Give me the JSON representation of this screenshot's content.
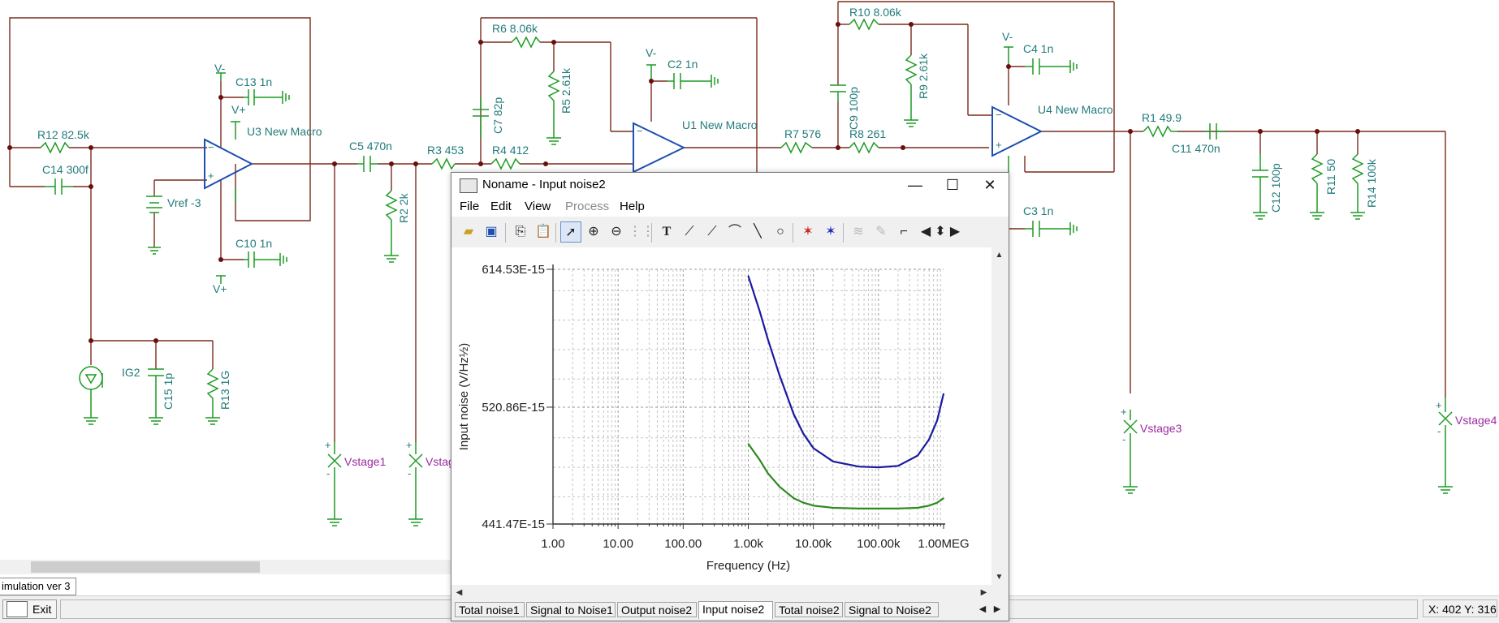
{
  "schematic": {
    "labels": {
      "r12": "R12 82.5k",
      "c14": "C14 300f",
      "c13": "C13 1n",
      "vminus_u3": "V-",
      "vplus_u3_top": "V+",
      "u3": "U3 New Macro",
      "vref": "Vref -3",
      "c10": "C10 1n",
      "vplus_u3_bot": "V+",
      "ig2": "IG2",
      "c15": "C15 1p",
      "r13": "R13 1G",
      "c5": "C5 470n",
      "r2": "R2 2k",
      "r3": "R3 453",
      "r4": "R4 412",
      "r6": "R6 8.06k",
      "c7": "C7 82p",
      "r5": "R5 2.61k",
      "vminus_u1": "V-",
      "c2": "C2 1n",
      "u1": "U1 New Macro",
      "r7": "R7 576",
      "r8": "R8 261",
      "c9": "C9 100p",
      "r10": "R10 8.06k",
      "r9": "R9 2.61k",
      "vminus_u4": "V-",
      "c4": "C4 1n",
      "u4": "U4 New Macro",
      "c3": "C3 1n",
      "r1": "R1 49.9",
      "c11": "C11 470n",
      "c12": "C12 100p",
      "r11": "R11 50",
      "r14": "R14 100k",
      "vstage1": "Vstage1",
      "vstage2": "Vstag",
      "vstage3": "Vstage3",
      "vstage4": "Vstage4"
    }
  },
  "main": {
    "tab_label": "imulation ver 3",
    "exit_label": "Exit",
    "coords": "X: 402  Y: 316"
  },
  "window": {
    "title": "Noname - Input noise2",
    "menu": [
      "File",
      "Edit",
      "View",
      "Process",
      "Help"
    ],
    "menu_disabled": [
      false,
      false,
      false,
      true,
      false
    ],
    "tabs": [
      "Total noise1",
      "Signal to Noise1",
      "Output noise2",
      "Input noise2",
      "Total noise2",
      "Signal to Noise2"
    ],
    "active_tab": "Input noise2",
    "toolbar_icons": [
      "open-icon",
      "save-icon",
      "copy-icon",
      "paste-icon",
      "pointer-icon",
      "zoom-in-icon",
      "zoom-out-icon",
      "grid-icon",
      "text-icon",
      "cursor-a-icon",
      "cursor-b-icon",
      "line-tool-icon",
      "line-icon",
      "circle-icon",
      "cursor-a-marker-icon",
      "cursor-b-marker-icon",
      "curve-icon",
      "pen-icon",
      "step-icon"
    ]
  },
  "chart_data": {
    "type": "line",
    "title": "",
    "xlabel": "Frequency (Hz)",
    "ylabel": "Input noise (V/Hz½)",
    "xscale": "log",
    "xlim": [
      1,
      1000000
    ],
    "ylim": [
      4.4147e-13,
      6.1453e-13
    ],
    "x_ticks": [
      "1.00",
      "10.00",
      "100.00",
      "1.00k",
      "10.00k",
      "100.00k",
      "1.00MEG"
    ],
    "y_ticks": [
      "614.53E-15",
      "520.86E-15",
      "441.47E-15"
    ],
    "y_tick_values": [
      6.1453e-13,
      5.2086e-13,
      4.4147e-13
    ],
    "grid": true,
    "series": [
      {
        "color": "#1a1aa0",
        "x": [
          1000,
          1500,
          2000,
          3000,
          5000,
          7000,
          10000,
          20000,
          50000,
          100000,
          200000,
          400000,
          600000,
          800000,
          1000000
        ],
        "y": [
          6.1e-13,
          5.86e-13,
          5.67e-13,
          5.43e-13,
          5.16e-13,
          5.03e-13,
          4.93e-13,
          4.84e-13,
          4.805e-13,
          4.8e-13,
          4.81e-13,
          4.88e-13,
          4.99e-13,
          5.12e-13,
          5.3e-13
        ]
      },
      {
        "color": "#2e8b1e",
        "x": [
          1000,
          1500,
          2000,
          3000,
          5000,
          7000,
          10000,
          20000,
          50000,
          100000,
          200000,
          400000,
          600000,
          800000,
          1000000
        ],
        "y": [
          4.96e-13,
          4.85e-13,
          4.76e-13,
          4.67e-13,
          4.59e-13,
          4.56e-13,
          4.54e-13,
          4.525e-13,
          4.52e-13,
          4.52e-13,
          4.52e-13,
          4.525e-13,
          4.54e-13,
          4.56e-13,
          4.59e-13
        ]
      }
    ]
  }
}
